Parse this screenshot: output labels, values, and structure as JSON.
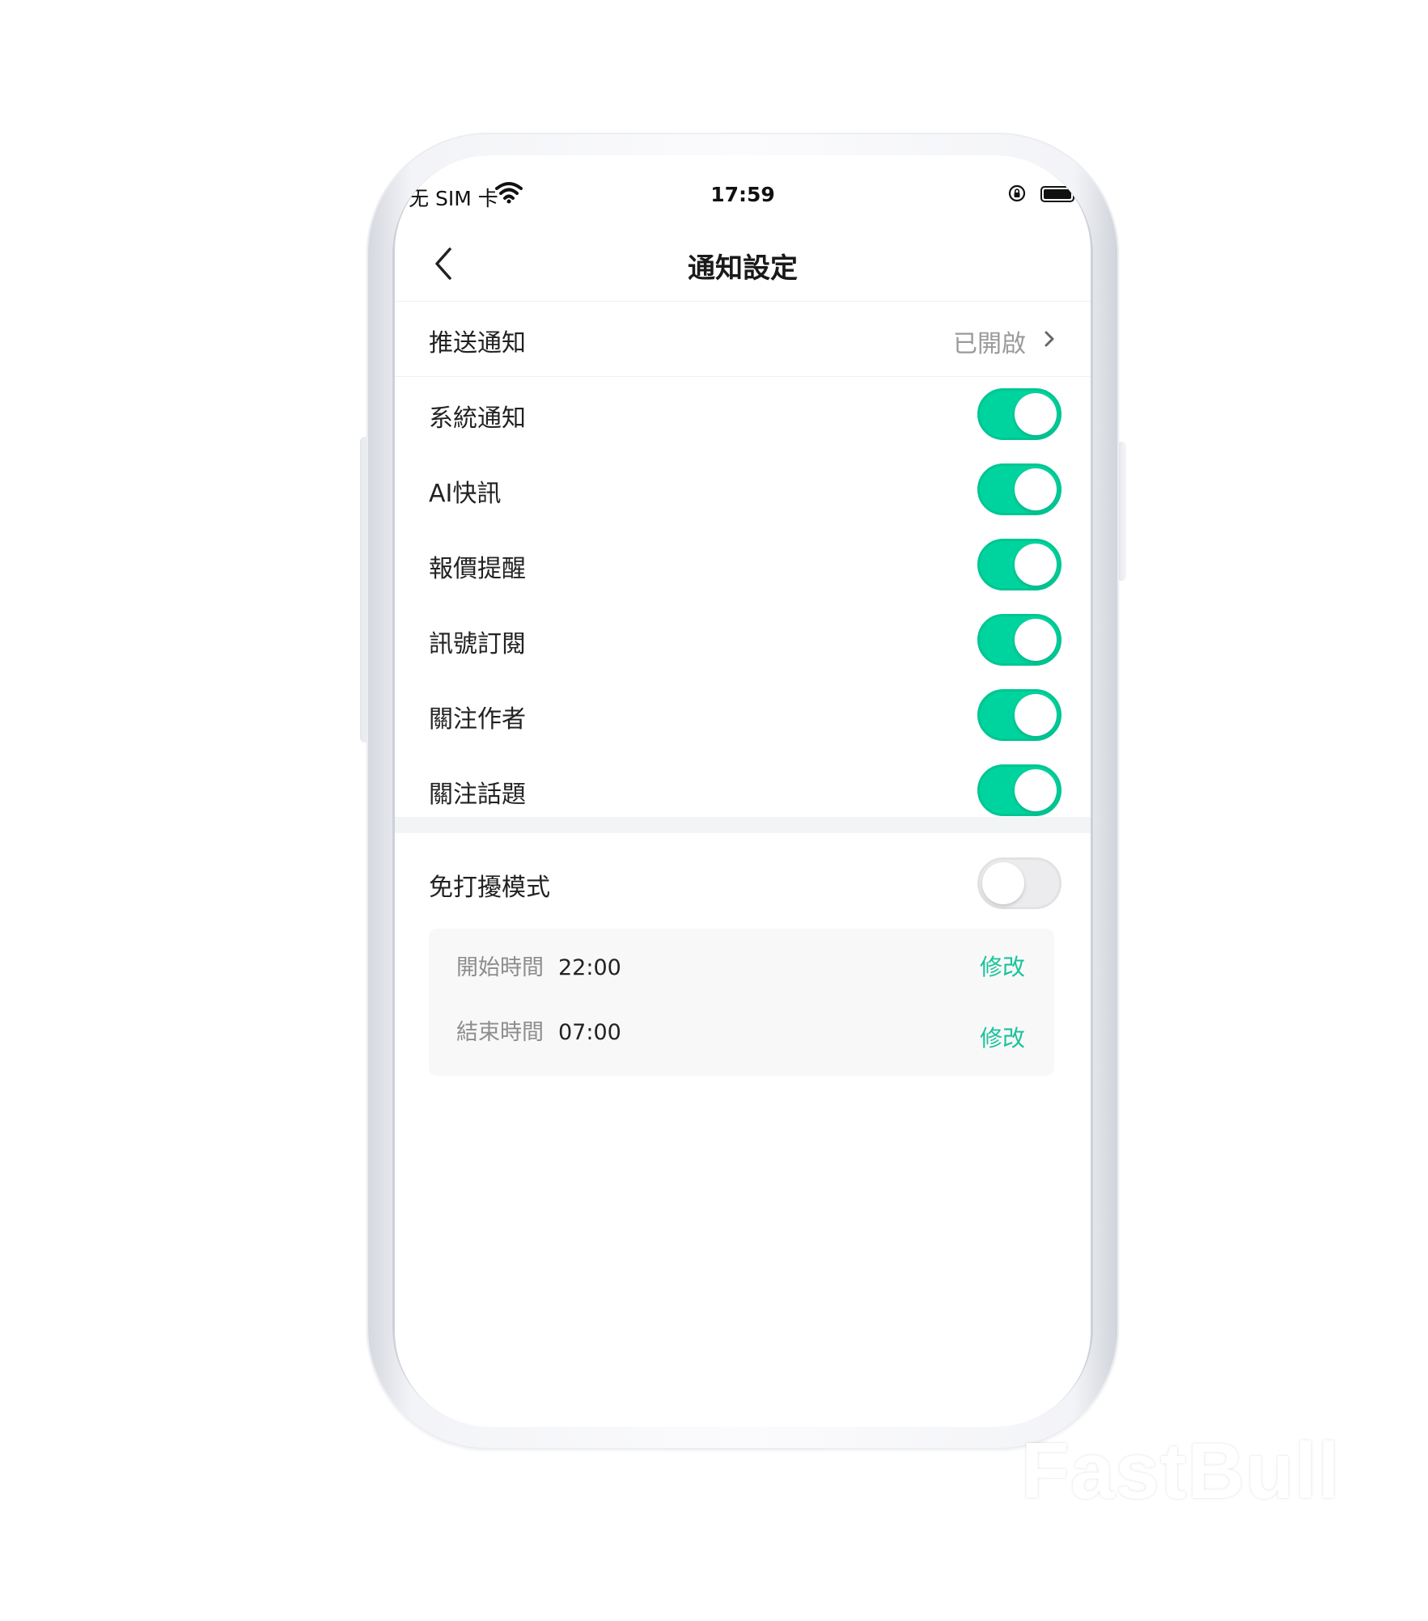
{
  "status_bar": {
    "carrier": "无 SIM 卡",
    "time": "17:59",
    "wifi_icon": "wifi-icon",
    "lock_icon": "rotation-lock-icon",
    "battery_icon": "battery-icon"
  },
  "nav": {
    "title": "通知設定",
    "back_icon": "chevron-left-icon"
  },
  "push": {
    "label": "推送通知",
    "status": "已開啟",
    "chevron_icon": "chevron-right-icon"
  },
  "toggles": [
    {
      "label": "系統通知",
      "on": true
    },
    {
      "label": "AI快訊",
      "on": true
    },
    {
      "label": "報價提醒",
      "on": true
    },
    {
      "label": "訊號訂閱",
      "on": true
    },
    {
      "label": "關注作者",
      "on": true
    },
    {
      "label": "關注話題",
      "on": true
    }
  ],
  "dnd": {
    "label": "免打擾模式",
    "on": false,
    "start_label": "開始時間",
    "start_value": "22:00",
    "end_label": "結束時間",
    "end_value": "07:00",
    "edit_label": "修改"
  },
  "colors": {
    "accent": "#00d49e",
    "link": "#19c39a",
    "muted": "#9a9a9a"
  },
  "watermark": "FastBull"
}
